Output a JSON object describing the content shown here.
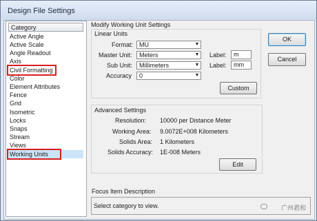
{
  "window": {
    "title": "Design File Settings"
  },
  "category": {
    "header": "Category",
    "items": [
      "Active Angle",
      "Active Scale",
      "Angle Readout",
      "Axis",
      "Civil Formatting",
      "Color",
      "Element Attributes",
      "Fence",
      "Grid",
      "Isometric",
      "Locks",
      "Snaps",
      "Stream",
      "Views",
      "Working Units"
    ],
    "selected": "Working Units"
  },
  "main": {
    "title": "Modify Working Unit Settings",
    "linear_units": {
      "label": "Linear Units",
      "format_label": "Format:",
      "format_value": "MU",
      "master_label": "Master Unit:",
      "master_value": "Meters",
      "sub_label": "Sub Unit:",
      "sub_value": "Millimeters",
      "accuracy_label": "Accuracy",
      "accuracy_value": "0",
      "master_label_label": "Label:",
      "master_label_value": "m",
      "sub_label_label": "Label:",
      "sub_label_value": "mm",
      "custom_button": "Custom"
    },
    "advanced": {
      "label": "Advanced Settings",
      "resolution_label": "Resolution:",
      "resolution_value": "10000 per Distance Meter",
      "working_area_label": "Working Area:",
      "working_area_value": "9.0072E+008 Kilometers",
      "solids_area_label": "Solids Area:",
      "solids_area_value": "1 Kilometers",
      "solids_accuracy_label": "Solids Accuracy:",
      "solids_accuracy_value": "1E-008 Meters",
      "edit_button": "Edit"
    },
    "focus": {
      "label": "Focus Item Description",
      "text": "Select category to view."
    }
  },
  "buttons": {
    "ok": "OK",
    "cancel": "Cancel"
  },
  "watermark": "广州君和"
}
